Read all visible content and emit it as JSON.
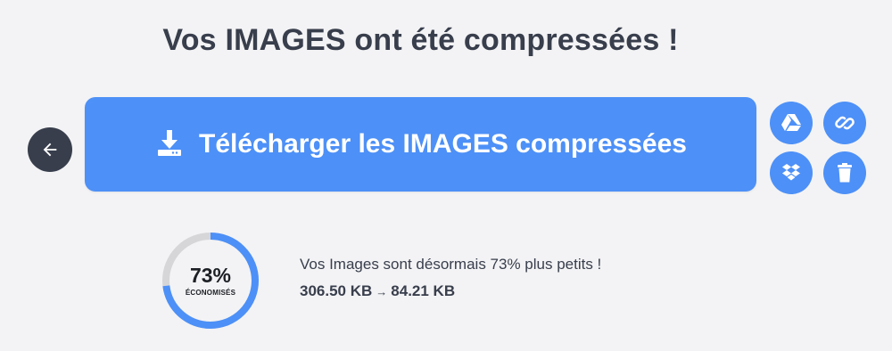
{
  "header": {
    "title": "Vos IMAGES ont été compressées !"
  },
  "actions": {
    "download_label": "Télécharger les IMAGES compressées",
    "back_icon": "arrow-left-icon",
    "download_icon": "download-icon",
    "google_drive_icon": "google-drive-icon",
    "link_icon": "link-icon",
    "dropbox_icon": "dropbox-icon",
    "delete_icon": "trash-icon"
  },
  "result": {
    "percent_label": "73%",
    "percent_value": 0.73,
    "gauge_caption": "ÉCONOMISÉS",
    "message": "Vos Images sont désormais 73% plus petits !",
    "original_size": "306.50 KB",
    "arrow": "→",
    "compressed_size": "84.21 KB"
  },
  "colors": {
    "accent": "#4d90f7",
    "dark": "#383e4c",
    "background": "#f3f3f5",
    "gauge_track": "#d6d6d8"
  }
}
